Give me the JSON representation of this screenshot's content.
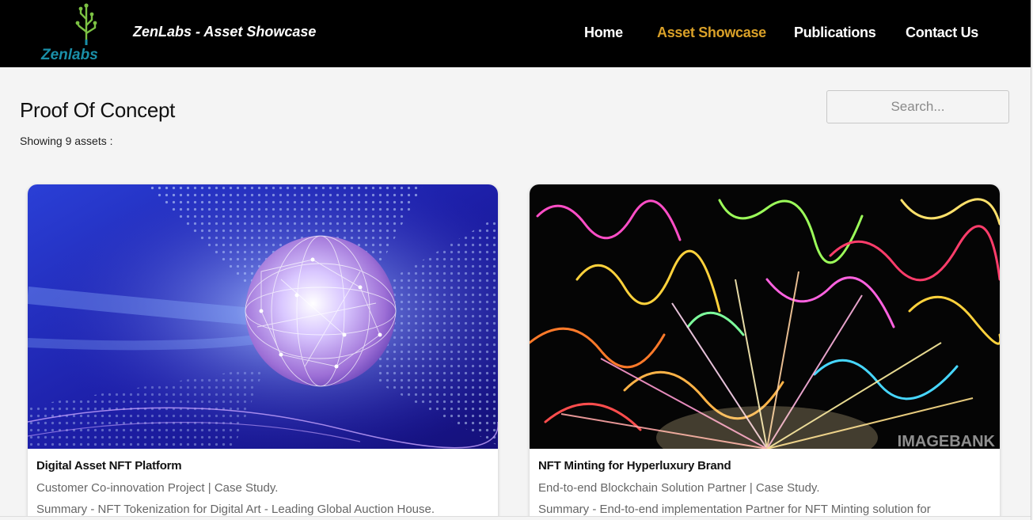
{
  "header": {
    "logo_text": "Zenlabs",
    "brand_title": "ZenLabs - Asset Showcase",
    "nav": [
      {
        "label": "Home",
        "active": false
      },
      {
        "label": "Asset Showcase",
        "active": true
      },
      {
        "label": "Publications",
        "active": false
      },
      {
        "label": "Contact Us",
        "active": false
      }
    ]
  },
  "main": {
    "title": "Proof Of Concept",
    "asset_count_text": "Showing 9 assets :",
    "search": {
      "placeholder": "Search..."
    }
  },
  "cards": [
    {
      "title": "Digital Asset NFT Platform",
      "subtitle": "Customer Co-innovation Project | Case Study.",
      "summary": "Summary - NFT Tokenization for Digital Art - Leading Global Auction House."
    },
    {
      "title": "NFT Minting for Hyperluxury Brand",
      "subtitle": "End-to-end Blockchain Solution Partner | Case Study.",
      "summary": "Summary - End-to-end implementation Partner for NFT Minting solution for",
      "image_watermark": "IMAGEBANK"
    }
  ],
  "colors": {
    "navbar": "#000000",
    "nav_text": "#ffffff",
    "nav_active": "#d9a028",
    "page_bg": "#f4f4f4",
    "logo_green": "#5cb85c",
    "logo_teal": "#1a8fa8"
  }
}
